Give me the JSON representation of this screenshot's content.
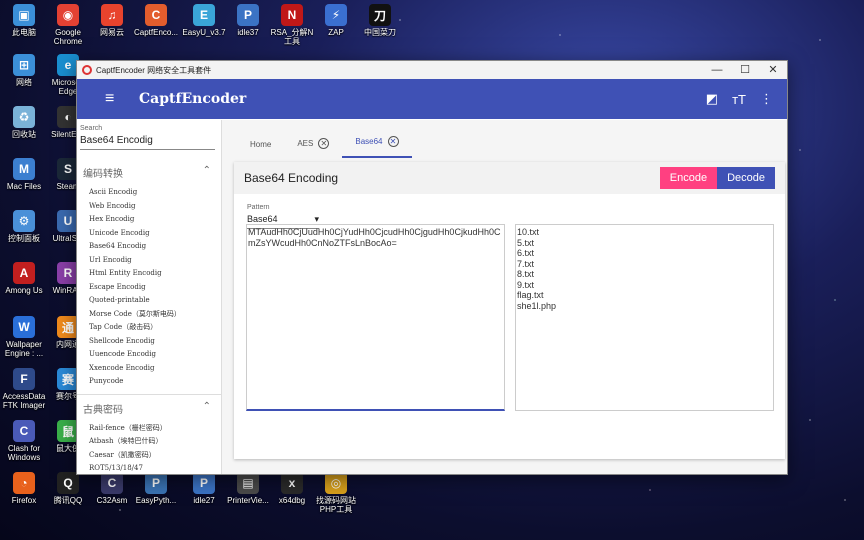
{
  "desktop": {
    "icons": [
      {
        "label": "此电脑",
        "color": "#3b8fd8",
        "glyph": "▣"
      },
      {
        "label": "Google Chrome",
        "color": "#e34133",
        "glyph": "◉"
      },
      {
        "label": "网易云",
        "color": "#e8432d",
        "glyph": "♫"
      },
      {
        "label": "CaptfEnco...",
        "color": "#e35d2d",
        "glyph": "C"
      },
      {
        "label": "EasyU_v3.7",
        "color": "#3aa5d8",
        "glyph": "E"
      },
      {
        "label": "idle37",
        "color": "#3b73c4",
        "glyph": "P"
      },
      {
        "label": "RSA_分解N 工具",
        "color": "#c01818",
        "glyph": "N"
      },
      {
        "label": "ZAP",
        "color": "#3a6fd0",
        "glyph": "⚡"
      },
      {
        "label": "中国菜刀",
        "color": "#111111",
        "glyph": "刀"
      },
      {
        "label": "网络",
        "color": "#3b8fd8",
        "glyph": "⊞"
      },
      {
        "label": "Microsoft Edge",
        "color": "#1a8fd0",
        "glyph": "e"
      },
      {
        "label": "回收站",
        "color": "#7ab2d8",
        "glyph": "♻"
      },
      {
        "label": "SilentEye",
        "color": "#333333",
        "glyph": "◐"
      },
      {
        "label": "Mac Files",
        "color": "#3c7fd0",
        "glyph": "M"
      },
      {
        "label": "Steam",
        "color": "#1b2838",
        "glyph": "S"
      },
      {
        "label": "控制面板",
        "color": "#4a90d8",
        "glyph": "⚙"
      },
      {
        "label": "UltraISO",
        "color": "#3a6ab0",
        "glyph": "U"
      },
      {
        "label": "Among Us",
        "color": "#c21f1f",
        "glyph": "A"
      },
      {
        "label": "WinRAR",
        "color": "#8a3fa8",
        "glyph": "R"
      },
      {
        "label": "Wallpaper Engine : ...",
        "color": "#2a6fd8",
        "glyph": "W"
      },
      {
        "label": "内网通",
        "color": "#f08a1c",
        "glyph": "通"
      },
      {
        "label": "AccessData FTK Imager",
        "color": "#2e4a8a",
        "glyph": "F"
      },
      {
        "label": "赛尔号",
        "color": "#2a8ad8",
        "glyph": "赛"
      },
      {
        "label": "Clash for Windows",
        "color": "#4a5ab8",
        "glyph": "C"
      },
      {
        "label": "鼠大侠",
        "color": "#3ab04a",
        "glyph": "鼠"
      },
      {
        "label": "Firefox",
        "color": "#e8611c",
        "glyph": "◔"
      },
      {
        "label": "腾讯QQ",
        "color": "#222222",
        "glyph": "Q"
      },
      {
        "label": "C32Asm",
        "color": "#3a3a6a",
        "glyph": "C"
      },
      {
        "label": "EasyPyth...",
        "color": "#3a73b4",
        "glyph": "P"
      },
      {
        "label": "idle27",
        "color": "#3b73c4",
        "glyph": "P"
      },
      {
        "label": "PrinterVie...",
        "color": "#4a4a4a",
        "glyph": "▤"
      },
      {
        "label": "x64dbg",
        "color": "#2a2a2a",
        "glyph": "x"
      },
      {
        "label": "找源码网站 PHP工具",
        "color": "#d8a01c",
        "glyph": "◎"
      }
    ]
  },
  "window": {
    "title": "CaptfEncoder 网络安全工具套件",
    "minimize_glyph": "—",
    "maximize_glyph": "☐",
    "close_glyph": "✕"
  },
  "appbar": {
    "menu_glyph": "≡",
    "title": "CaptfEncoder",
    "theme_glyph": "◩",
    "font_glyph": "ᴛT",
    "more_glyph": "⋮"
  },
  "sidebar": {
    "search_label": "Search",
    "search_value": "Base64 Encodig",
    "categories": [
      {
        "name": "编码转换",
        "chevron": "⌃",
        "items": [
          "Ascii Encodig",
          "Web Encodig",
          "Hex Encodig",
          "Unicode Encodig",
          "Base64 Encodig",
          "Url Encodig",
          "Html Entity Encodig",
          "Escape Encodig",
          "Quoted-printable",
          "Morse Code（莫尔斯电码）",
          "Tap Code（敲击码）",
          "Shellcode Encodig",
          "Uuencode Encodig",
          "Xxencode Encodig",
          "Punycode"
        ]
      },
      {
        "name": "古典密码",
        "chevron": "⌃",
        "items": [
          "Rail-fence（栅栏密码）",
          "Atbash（埃特巴什码）",
          "Caesar（凯撒密码）",
          "ROT5/13/18/47"
        ]
      }
    ]
  },
  "tabs": [
    {
      "label": "Home",
      "closable": false,
      "active": false
    },
    {
      "label": "AES",
      "closable": true,
      "active": false
    },
    {
      "label": "Base64",
      "closable": true,
      "active": true
    }
  ],
  "tab_close_glyph": "✕",
  "card": {
    "title": "Base64 Encoding",
    "encode_label": "Encode",
    "decode_label": "Decode",
    "pattern_label": "Pattern",
    "pattern_value": "Base64",
    "pattern_arrow": "▾",
    "input_text": "MTAudHh0CjUudHh0CjYudHh0CjcudHh0CjgudHh0CjkudHh0CmZsYWcudHh0CnNoZTFsLnBocAo=",
    "output_text": "10.txt\n5.txt\n6.txt\n7.txt\n8.txt\n9.txt\nflag.txt\nshe1l.php"
  }
}
